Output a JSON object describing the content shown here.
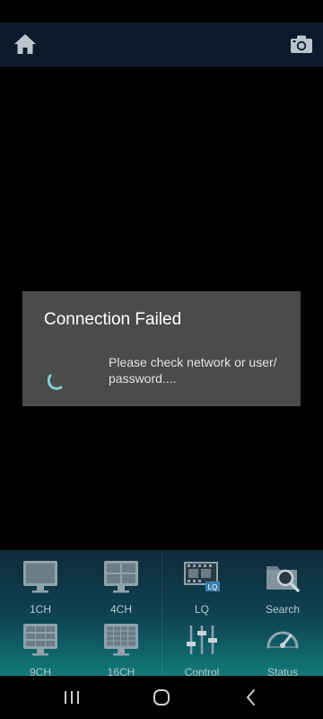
{
  "dialog": {
    "title": "Connection Failed",
    "message": "Please check network or user/ password...."
  },
  "toolbar": {
    "home_icon": "home-icon",
    "camera_icon": "camera-icon"
  },
  "controls": [
    {
      "label": "1CH",
      "icon": "single-screen-icon"
    },
    {
      "label": "4CH",
      "icon": "quad-screen-icon"
    },
    {
      "label": "LQ",
      "icon": "low-quality-film-icon"
    },
    {
      "label": "Search",
      "icon": "search-folder-icon"
    },
    {
      "label": "9CH",
      "icon": "nine-grid-screen-icon"
    },
    {
      "label": "16CH",
      "icon": "sixteen-grid-screen-icon"
    },
    {
      "label": "Control",
      "icon": "sliders-icon"
    },
    {
      "label": "Status",
      "icon": "gauge-icon"
    }
  ],
  "colors": {
    "topbar": "#0b1a2a",
    "dialog": "#4b4b4b",
    "spinner": "#7fd0cf",
    "control_icon": "#8fa3ad"
  }
}
